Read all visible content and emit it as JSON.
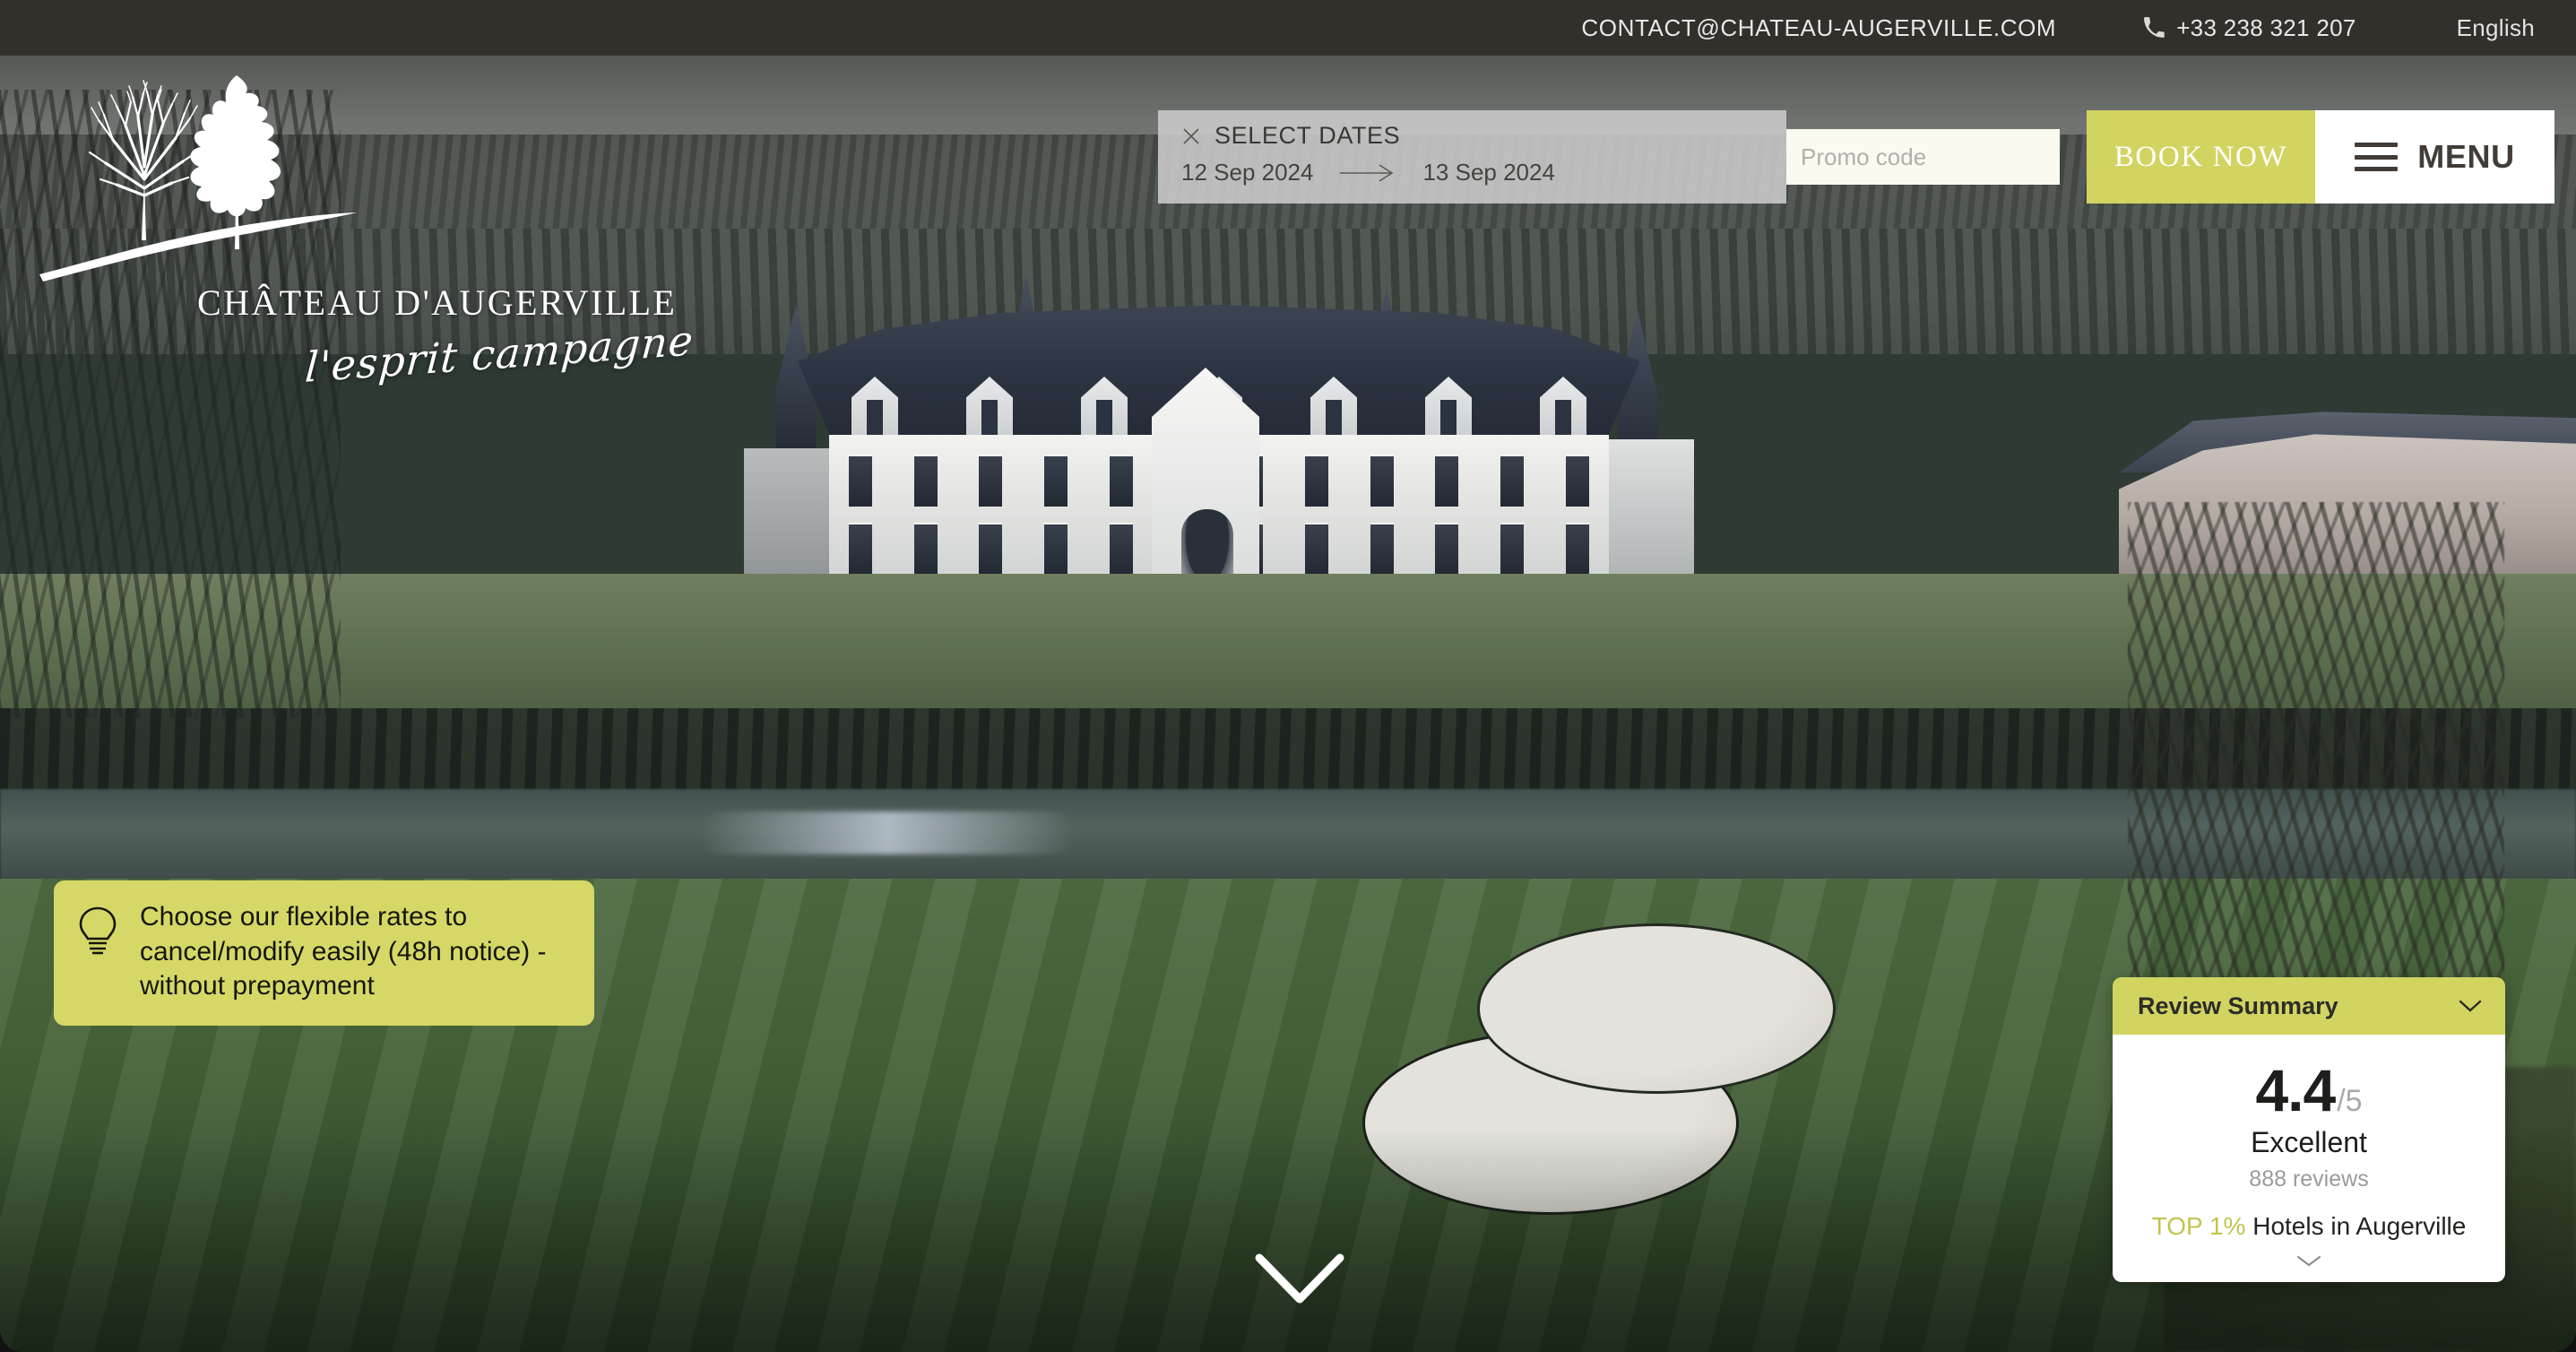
{
  "topbar": {
    "email": "CONTACT@CHATEAU-AUGERVILLE.COM",
    "phone": "+33 238 321 207",
    "language": "English",
    "phone_icon": "phone-icon"
  },
  "booking": {
    "close_icon": "close-icon",
    "label": "SELECT DATES",
    "checkin": "12 Sep 2024",
    "checkout": "13 Sep 2024",
    "arrow_icon": "arrow-right-icon",
    "promo_placeholder": "Promo code",
    "promo_value": "",
    "book_label": "BOOK NOW",
    "menu_label": "MENU",
    "menu_icon": "hamburger-icon",
    "accent_color": "#D2D462",
    "bar_bg_color": "#CBCBCB",
    "promo_bg_color": "#FAFAF0"
  },
  "logo": {
    "mark_icon": "two-trees-on-hill-icon",
    "name": "CHÂTEAU D'AUGERVILLE",
    "tagline": "l'esprit campagne"
  },
  "notice": {
    "icon": "lightbulb-icon",
    "text": "Choose our flexible rates to cancel/modify easily (48h notice) - without prepayment",
    "bg_color": "#D5D866"
  },
  "reviews": {
    "title": "Review Summary",
    "collapse_icon": "chevron-down-icon",
    "score": "4.4",
    "score_out_of": "/5",
    "rating_word": "Excellent",
    "review_count": "888 reviews",
    "rank_highlight": "TOP 1%",
    "rank_text": " Hotels in Augerville",
    "expand_icon": "chevron-down-icon",
    "header_color": "#D2D462",
    "highlight_color": "#C2C44F"
  },
  "hero": {
    "scroll_cue_icon": "chevron-down-icon",
    "alt": "Aerial view of Château d'Augerville with golf course fairway and bunker"
  }
}
